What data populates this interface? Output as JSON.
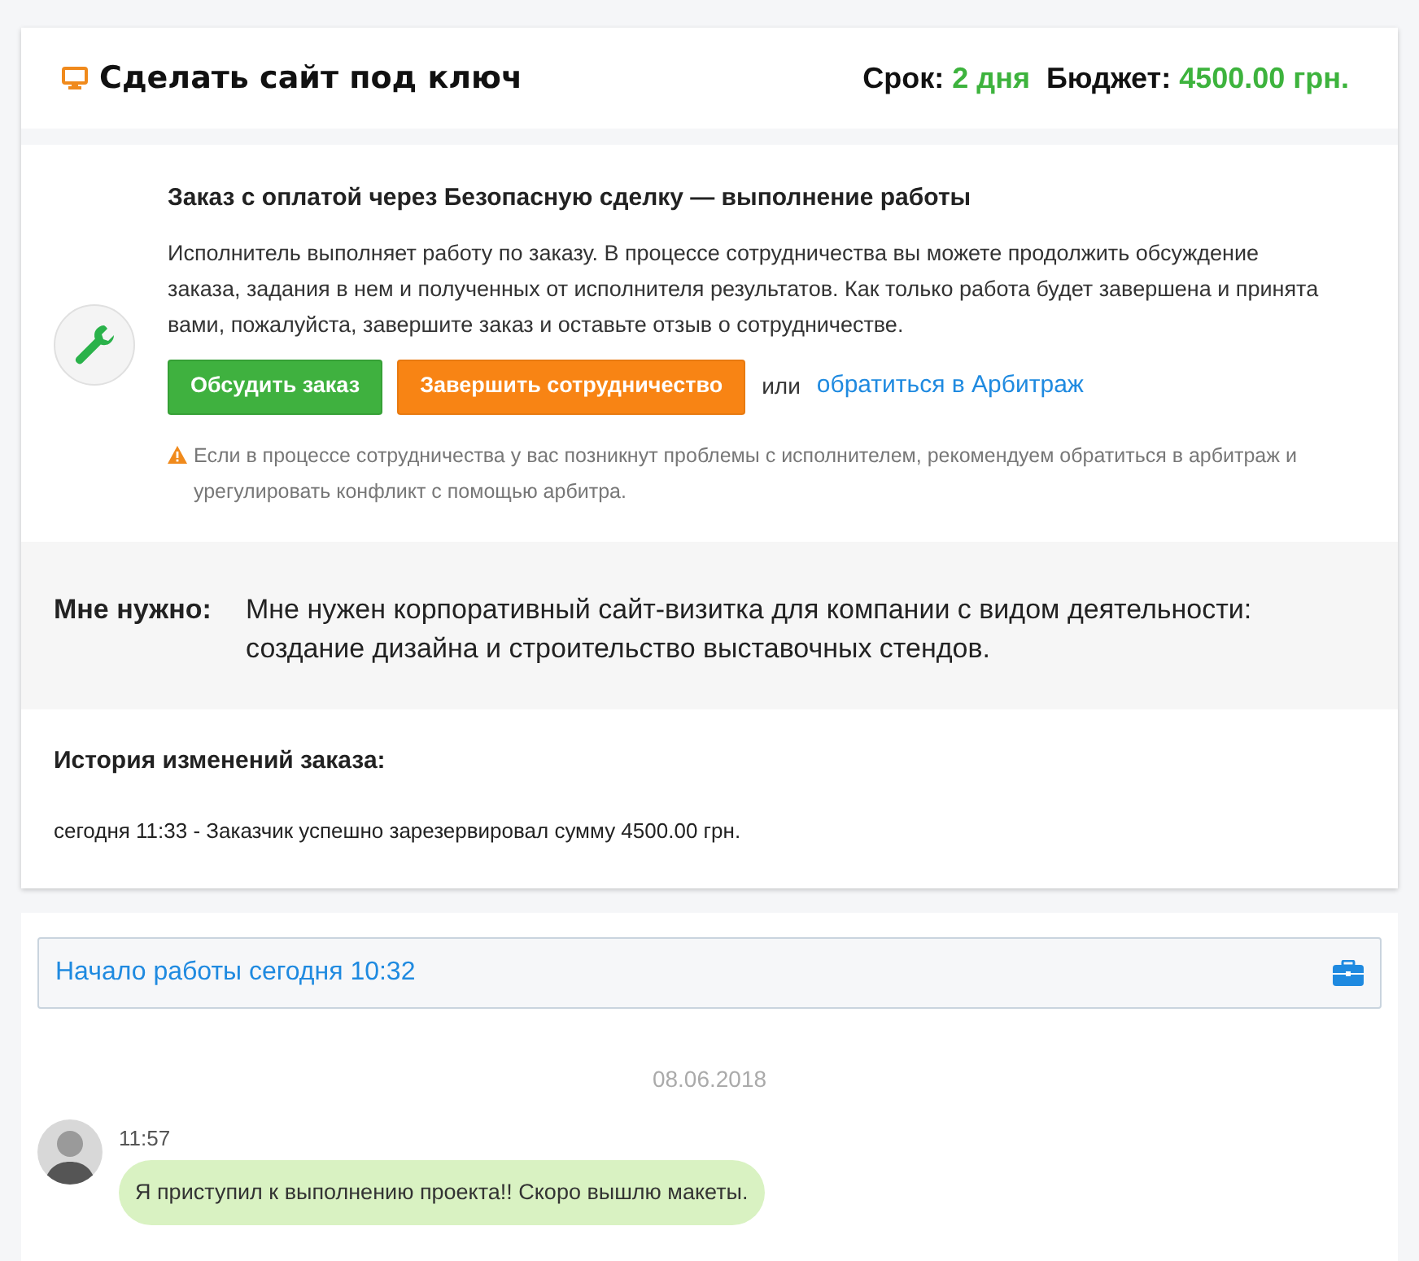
{
  "order": {
    "title": "Сделать сайт под ключ",
    "term_label": "Срок:",
    "term_value": "2 дня",
    "budget_label": "Бюджет:",
    "budget_value": "4500.00 грн."
  },
  "safe_deal": {
    "title": "Заказ с оплатой через Безопасную сделку — выполнение работы",
    "description": "Исполнитель выполняет работу по заказу. В процессе сотрудничества вы можете продолжить обсуждение заказа, задания в нем и полученных от исполнителя результатов. Как только работа будет завершена и принята вами, пожалуйста, завершите заказ и оставьте отзыв о сотрудничестве.",
    "buttons": [
      {
        "label": "Обсудить заказ",
        "kind": "green"
      },
      {
        "label": "Завершить сотрудничество",
        "kind": "orange"
      }
    ],
    "or_text": "или",
    "arbitration_link": "обратиться в Арбитраж",
    "warning": "Если в процессе сотрудничества у вас позникнут проблемы с исполнителем, рекомендуем обратиться в арбитраж и урегулировать конфликт с помощью арбитра."
  },
  "need": {
    "label": "Мне нужно:",
    "text": "Мне нужен корпоративный сайт-визитка для компании с видом деятельности: создание дизайна и строительство выставочных стендов."
  },
  "history": {
    "title": "История изменений заказа:",
    "entries": [
      "сегодня 11:33 - Заказчик успешно зарезервировал сумму 4500.00 грн."
    ]
  },
  "chat": {
    "start_banner": "Начало работы сегодня 10:32",
    "date": "08.06.2018",
    "messages": [
      {
        "time": "11:57",
        "text": "Я приступил к выполнению проекта!! Скоро вышлю макеты."
      }
    ]
  }
}
